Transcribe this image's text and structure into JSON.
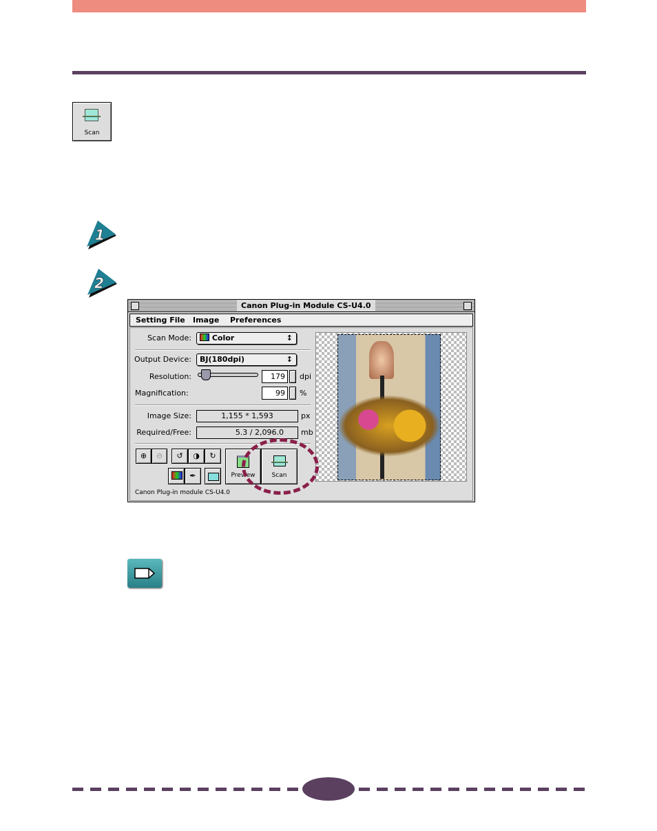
{
  "scan_icon_button": {
    "label": "Scan"
  },
  "steps": [
    {
      "number": "1"
    },
    {
      "number": "2"
    }
  ],
  "dialog": {
    "title": "Canon Plug-in Module CS-U4.0",
    "menu": [
      "Setting File",
      "Image",
      "Preferences"
    ],
    "scan_mode": {
      "label": "Scan Mode:",
      "value": "Color"
    },
    "output_device": {
      "label": "Output Device:",
      "value": "BJ(180dpi)"
    },
    "resolution": {
      "label": "Resolution:",
      "value": "179",
      "unit": "dpi"
    },
    "magnification": {
      "label": "Magnification:",
      "value": "99",
      "unit": "%"
    },
    "image_size": {
      "label": "Image Size:",
      "value": "1,155 * 1,593",
      "unit": "px"
    },
    "required_free": {
      "label": "Required/Free:",
      "value": "5.3 / 2,096.0",
      "unit": "mb"
    },
    "preview_button": "Preview",
    "scan_button": "Scan",
    "status": "Canon Plug-in module CS-U4.0"
  },
  "colors": {
    "header_bar": "#ee8c80",
    "rule": "#5b4060",
    "highlight_circle": "#8a1f4a",
    "step_arrow": "#1f7f93",
    "note_icon": "#3a9aa0"
  }
}
